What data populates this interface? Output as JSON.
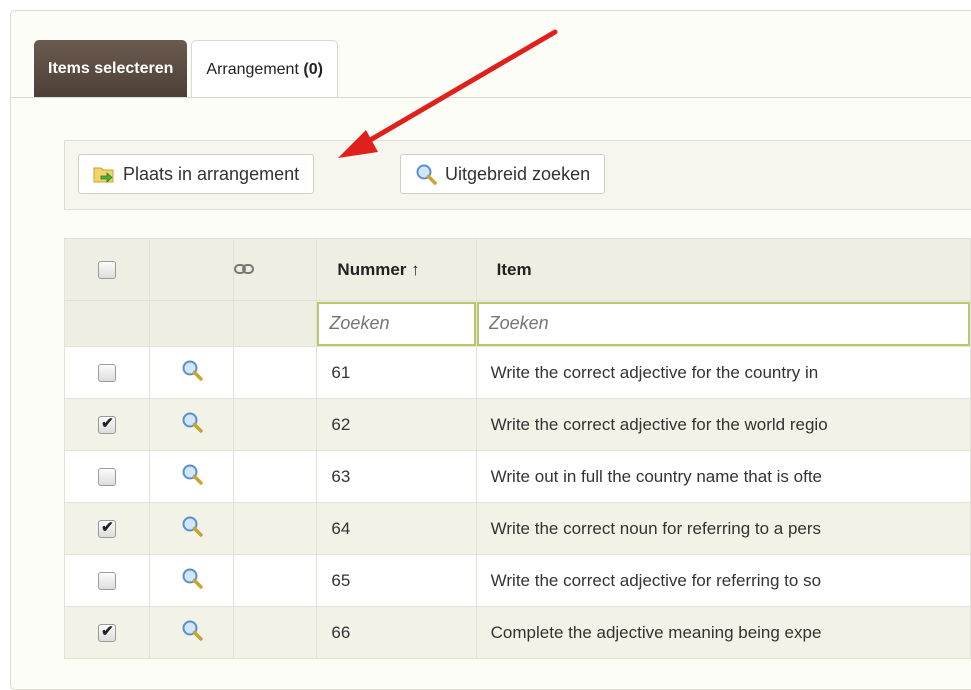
{
  "tabs": {
    "items_selecteren": "Items selecteren",
    "arrangement_label": "Arrangement",
    "arrangement_count": "(0)"
  },
  "toolbar": {
    "place_label": "Plaats in arrangement",
    "search_label": "Uitgebreid zoeken"
  },
  "table": {
    "col_nummer": "Nummer",
    "sort_glyph": "↑",
    "col_item": "Item",
    "filter_placeholder": "Zoeken",
    "rows": [
      {
        "checked": false,
        "nummer": "61",
        "item": "Write the correct adjective for the country in"
      },
      {
        "checked": true,
        "nummer": "62",
        "item": "Write the correct adjective for the world regio"
      },
      {
        "checked": false,
        "nummer": "63",
        "item": "Write out in full the country name that is ofte"
      },
      {
        "checked": true,
        "nummer": "64",
        "item": "Write the correct noun for referring to a pers"
      },
      {
        "checked": false,
        "nummer": "65",
        "item": "Write the correct adjective for referring to so"
      },
      {
        "checked": true,
        "nummer": "66",
        "item": "Complete the adjective meaning being expe"
      }
    ]
  },
  "colors": {
    "tab_active": "#5a4a40",
    "filter_border": "#b8c96b",
    "annotation_arrow": "#e0201c"
  }
}
